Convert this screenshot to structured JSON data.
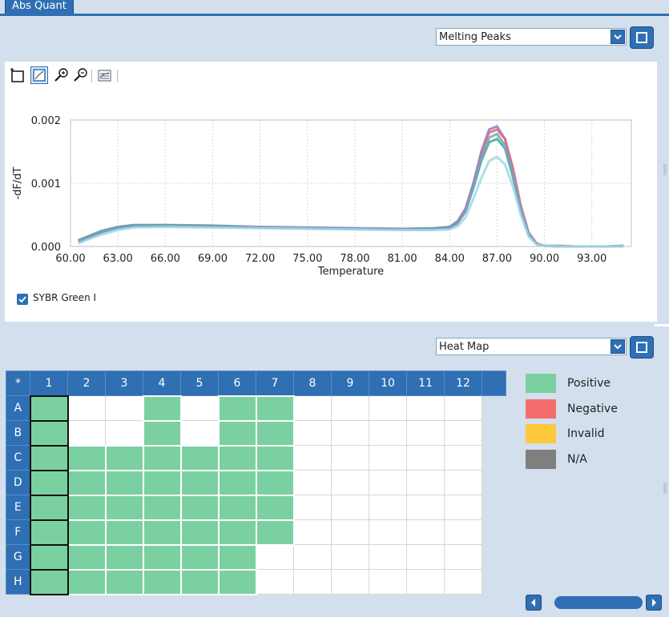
{
  "tab": {
    "label": "Abs Quant"
  },
  "top_panel": {
    "view_select": "Melting Peaks",
    "toolbar": [
      "select-tool",
      "zoom-box-tool",
      "zoom-in",
      "zoom-out",
      "legend-tool"
    ]
  },
  "chart_data": {
    "type": "line",
    "xlabel": "Temperature",
    "ylabel": "-dF/dT",
    "xlim": [
      60,
      95.5
    ],
    "ylim": [
      0,
      0.002
    ],
    "x_ticks": [
      "60.00",
      "63.00",
      "66.00",
      "69.00",
      "72.00",
      "75.00",
      "78.00",
      "81.00",
      "84.00",
      "87.00",
      "90.00",
      "93.00"
    ],
    "y_ticks": [
      "0.000",
      "0.001",
      "0.002"
    ],
    "grid": true,
    "x": [
      60.5,
      61,
      62,
      63,
      64,
      66,
      69,
      72,
      75,
      78,
      81,
      83,
      84,
      84.5,
      85,
      85.5,
      86,
      86.5,
      87,
      87.5,
      88,
      88.5,
      89,
      89.5,
      90,
      91,
      92,
      93,
      94,
      95
    ],
    "series": [
      {
        "color": "#8c7bc9",
        "values": [
          0.0001,
          0.00015,
          0.00025,
          0.00031,
          0.00034,
          0.00034,
          0.00033,
          0.00031,
          0.0003,
          0.00029,
          0.00028,
          0.00029,
          0.00031,
          0.0004,
          0.0006,
          0.001,
          0.0015,
          0.00185,
          0.0019,
          0.0017,
          0.0012,
          0.0006,
          0.0002,
          4e-05,
          1e-05,
          1e-05,
          0.0,
          0.0,
          0.0,
          1e-05
        ]
      },
      {
        "color": "#e06a78",
        "values": [
          6e-05,
          0.00012,
          0.00022,
          0.00029,
          0.00032,
          0.00033,
          0.00032,
          0.0003,
          0.00029,
          0.00028,
          0.00027,
          0.00028,
          0.0003,
          0.00038,
          0.00058,
          0.00098,
          0.00145,
          0.0018,
          0.00185,
          0.0017,
          0.00125,
          0.00065,
          0.00022,
          5e-05,
          1e-05,
          1e-05,
          0.0,
          0.0,
          0.0,
          1e-05
        ]
      },
      {
        "color": "#3fae8a",
        "values": [
          9e-05,
          0.00014,
          0.00024,
          0.0003,
          0.00033,
          0.00033,
          0.00032,
          0.0003,
          0.00029,
          0.00028,
          0.00027,
          0.00028,
          0.0003,
          0.00037,
          0.00055,
          0.00092,
          0.00135,
          0.00165,
          0.0017,
          0.00155,
          0.0011,
          0.00055,
          0.00018,
          4e-05,
          1e-05,
          0.0,
          0.0,
          0.0,
          0.0,
          1e-05
        ]
      },
      {
        "color": "#7aa0c8",
        "values": [
          8e-05,
          0.00013,
          0.00023,
          0.00029,
          0.00032,
          0.00032,
          0.00031,
          0.0003,
          0.00029,
          0.00028,
          0.00027,
          0.00027,
          0.00029,
          0.00036,
          0.00056,
          0.00095,
          0.0014,
          0.00172,
          0.00178,
          0.0016,
          0.00115,
          0.0006,
          0.0002,
          4e-05,
          1e-05,
          0.0,
          0.0,
          0.0,
          0.0,
          1e-05
        ]
      },
      {
        "color": "#9fd8e6",
        "values": [
          5e-05,
          0.0001,
          0.00019,
          0.00026,
          0.0003,
          0.00031,
          0.0003,
          0.00029,
          0.00028,
          0.00027,
          0.00026,
          0.00026,
          0.00027,
          0.00032,
          0.00046,
          0.00075,
          0.00108,
          0.00135,
          0.00142,
          0.0013,
          0.00095,
          0.0005,
          0.00016,
          3e-05,
          1e-05,
          0.0,
          0.0,
          0.0,
          0.0,
          0.0
        ]
      }
    ]
  },
  "legend": {
    "dye": "SYBR Green I",
    "checked": true
  },
  "bottom_panel": {
    "view_select": "Heat Map",
    "corner": "*",
    "columns": [
      "1",
      "2",
      "3",
      "4",
      "5",
      "6",
      "7",
      "8",
      "9",
      "10",
      "11",
      "12"
    ],
    "rows": [
      {
        "label": "A",
        "cells": [
          "sel",
          "",
          "",
          "pos",
          "",
          "pos",
          "pos",
          "",
          "",
          "",
          "",
          ""
        ]
      },
      {
        "label": "B",
        "cells": [
          "sel",
          "",
          "",
          "pos",
          "",
          "pos",
          "pos",
          "",
          "",
          "",
          "",
          ""
        ]
      },
      {
        "label": "C",
        "cells": [
          "sel",
          "pos",
          "pos",
          "pos",
          "pos",
          "pos",
          "pos",
          "",
          "",
          "",
          "",
          ""
        ]
      },
      {
        "label": "D",
        "cells": [
          "sel",
          "pos",
          "pos",
          "pos",
          "pos",
          "pos",
          "pos",
          "",
          "",
          "",
          "",
          ""
        ]
      },
      {
        "label": "E",
        "cells": [
          "sel",
          "pos",
          "pos",
          "pos",
          "pos",
          "pos",
          "pos",
          "",
          "",
          "",
          "",
          ""
        ]
      },
      {
        "label": "F",
        "cells": [
          "sel",
          "pos",
          "pos",
          "pos",
          "pos",
          "pos",
          "pos",
          "",
          "",
          "",
          "",
          ""
        ]
      },
      {
        "label": "G",
        "cells": [
          "sel",
          "pos",
          "pos",
          "pos",
          "pos",
          "pos",
          "",
          "",
          "",
          "",
          "",
          ""
        ]
      },
      {
        "label": "H",
        "cells": [
          "sel",
          "pos",
          "pos",
          "pos",
          "pos",
          "pos",
          "",
          "",
          "",
          "",
          "",
          ""
        ]
      }
    ],
    "legend": [
      {
        "label": "Positive",
        "color": "#7bd0a1"
      },
      {
        "label": "Negative",
        "color": "#f46d6d"
      },
      {
        "label": "Invalid",
        "color": "#fdc83a"
      },
      {
        "label": "N/A",
        "color": "#7f7f7f"
      }
    ]
  }
}
